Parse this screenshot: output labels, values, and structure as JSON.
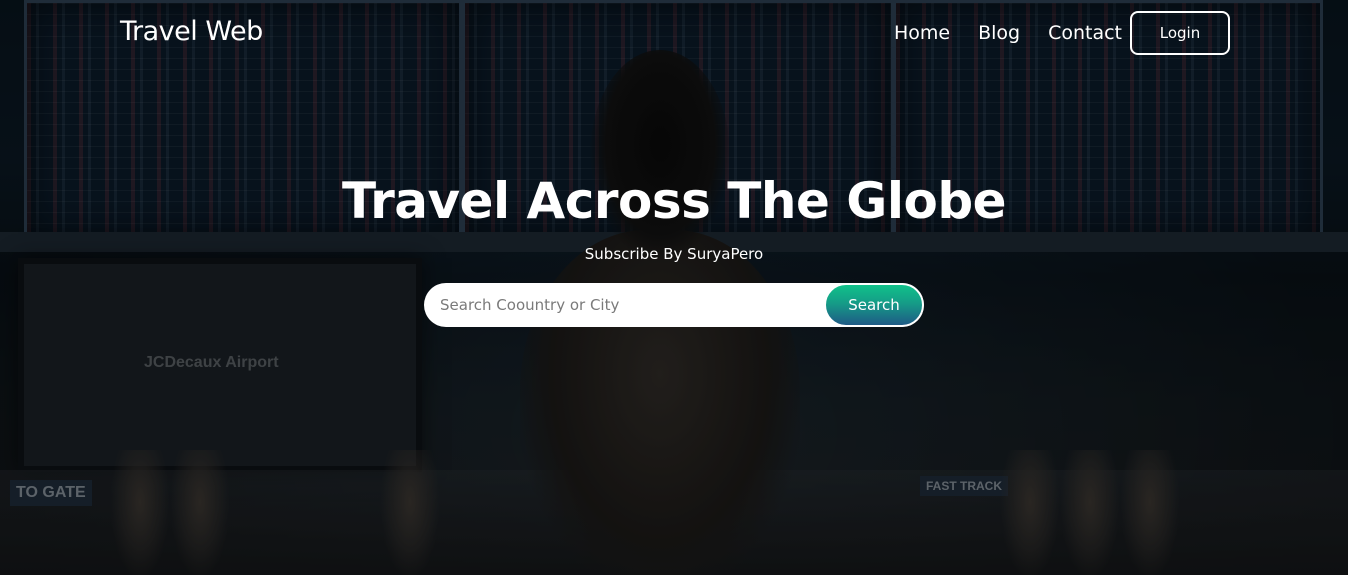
{
  "nav": {
    "logo": "Travel Web",
    "links": [
      "Home",
      "Blog",
      "Contact"
    ],
    "login_label": "Login"
  },
  "hero": {
    "title": "Travel Across The Globe",
    "subtitle": "Subscribe By SuryaPero",
    "search": {
      "placeholder": "Search Coountry or City",
      "button_label": "Search"
    }
  },
  "background": {
    "screen_text": "JCDecaux Airport",
    "signs": [
      "TO     GATE",
      "FAST TRACK"
    ]
  },
  "colors": {
    "search_button_top": "#10c28a",
    "search_button_bottom": "#1e5a86",
    "text": "#ffffff"
  }
}
